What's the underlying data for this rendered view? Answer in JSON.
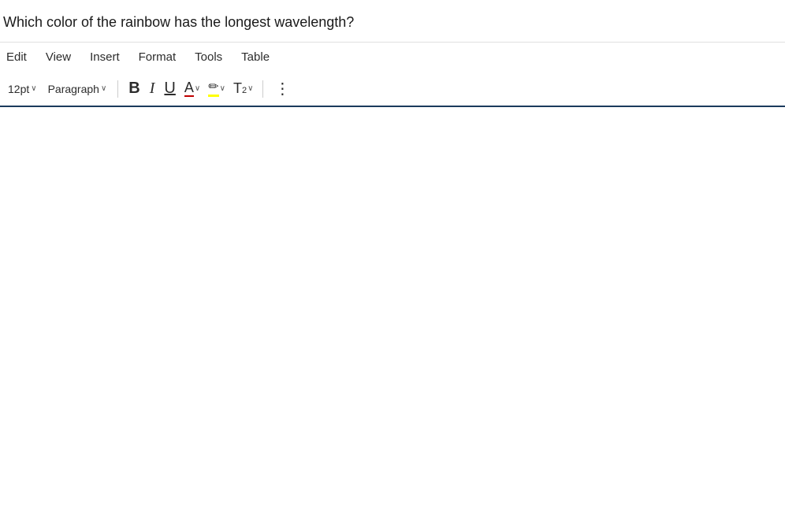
{
  "question": {
    "text": "Which color of the rainbow has the longest wavelength?"
  },
  "menu": {
    "items": [
      {
        "id": "edit",
        "label": "Edit"
      },
      {
        "id": "view",
        "label": "View"
      },
      {
        "id": "insert",
        "label": "Insert"
      },
      {
        "id": "format",
        "label": "Format"
      },
      {
        "id": "tools",
        "label": "Tools"
      },
      {
        "id": "table",
        "label": "Table"
      }
    ]
  },
  "toolbar": {
    "font_size": "12pt",
    "font_size_chevron": "∨",
    "paragraph": "Paragraph",
    "paragraph_chevron": "∨",
    "bold_label": "B",
    "italic_label": "I",
    "underline_label": "U",
    "font_color_letter": "A",
    "highlight_icon": "✏",
    "superscript_base": "T",
    "superscript_exp": "2",
    "more_icon": "⋮",
    "chevron": "∨"
  }
}
